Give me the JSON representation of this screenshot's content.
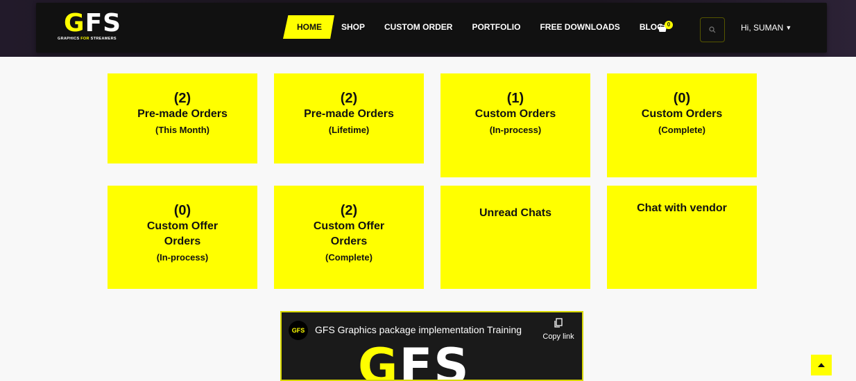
{
  "logo": {
    "main_prefix": "G",
    "main_rest": "FS",
    "sub_a": "GRAPHICS ",
    "sub_for": "FOR",
    "sub_b": " STREAMERS"
  },
  "nav": {
    "items": [
      "HOME",
      "SHOP",
      "CUSTOM ORDER",
      "PORTFOLIO",
      "FREE DOWNLOADS",
      "BLOG"
    ],
    "cart_count": "0",
    "user_greeting": "Hi, SUMAN"
  },
  "cards": [
    {
      "count": "(2)",
      "title": "Pre-made Orders",
      "sub": "(This Month)"
    },
    {
      "count": "(2)",
      "title": "Pre-made Orders",
      "sub": "(Lifetime)"
    },
    {
      "count": "(1)",
      "title": "Custom Orders",
      "sub": "(In-process)"
    },
    {
      "count": "(0)",
      "title": "Custom Orders",
      "sub": "(Complete)"
    },
    {
      "count": "(0)",
      "title_1": "Custom Offer",
      "title_2": "Orders",
      "sub": "(In-process)"
    },
    {
      "count": "(2)",
      "title_1": "Custom Offer",
      "title_2": "Orders",
      "sub": "(Complete)"
    },
    {
      "title": "Unread Chats"
    },
    {
      "title": "Chat with vendor"
    }
  ],
  "video": {
    "channel": "GFS",
    "title": "GFS Graphics package implementation Training",
    "copy_link": "Copy link",
    "logo_g": "G",
    "logo_rest": "FS"
  },
  "colors": {
    "accent": "#ffff00",
    "nav_bg": "#111111",
    "page_bg": "#f8f8f8"
  }
}
